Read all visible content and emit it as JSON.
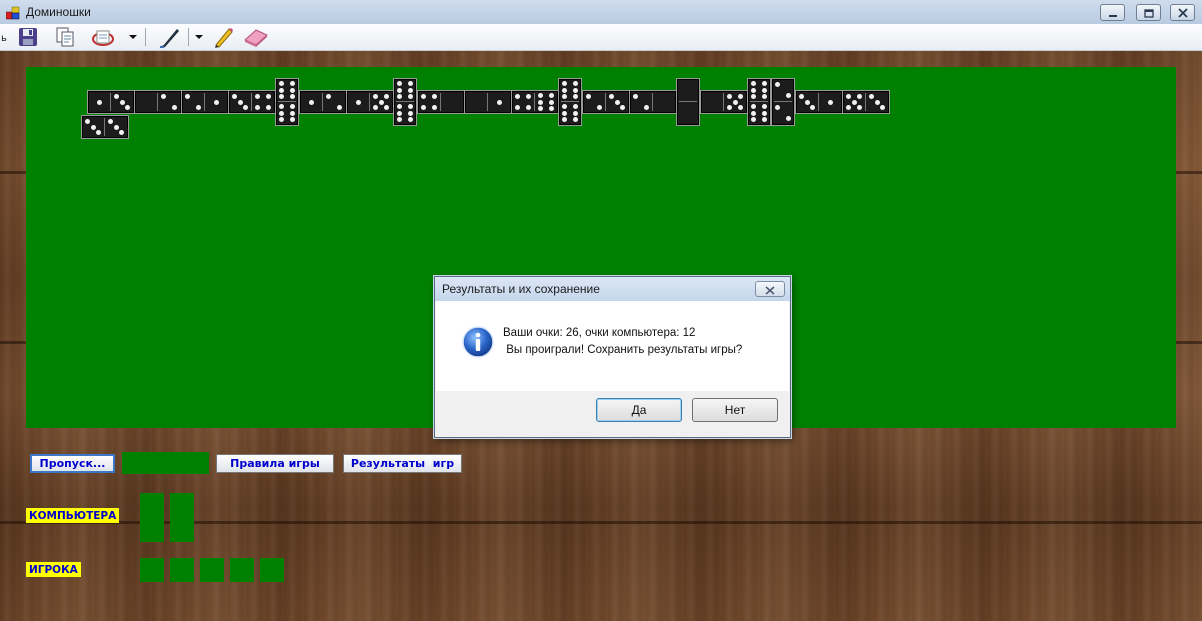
{
  "window": {
    "title": "Доминошки",
    "controls": [
      "minimize",
      "maximize",
      "close"
    ]
  },
  "toolbar": {
    "items": [
      "save-icon",
      "copy-icon",
      "open-icon",
      "dropdown-arrow-icon",
      "pen-icon",
      "dropdown-arrow-icon",
      "pencil-icon",
      "eraser-icon"
    ]
  },
  "board": {
    "background_color": "#008000",
    "chain_row1": [
      [
        1,
        3
      ],
      [
        0,
        2
      ],
      [
        2,
        1
      ],
      [
        3,
        4
      ],
      [
        6,
        6
      ],
      [
        1,
        2
      ],
      [
        1,
        5
      ],
      [
        6,
        6
      ],
      [
        4,
        0
      ],
      [
        0,
        1
      ],
      [
        4,
        6
      ],
      [
        6,
        6
      ],
      [
        2,
        3
      ],
      [
        2,
        0
      ],
      [
        0,
        0
      ],
      [
        0,
        5
      ],
      [
        6,
        6
      ],
      [
        2,
        2
      ],
      [
        3,
        1
      ],
      [
        5,
        3
      ]
    ],
    "chain_row2": [
      [
        3,
        3
      ]
    ]
  },
  "dialog": {
    "title": "Результаты и их сохранение",
    "line1": "Ваши очки: 26, очки компьютера: 12",
    "line2": " Вы проиграли! Сохранить результаты игры?",
    "yes_label": "Да",
    "no_label": "Нет",
    "icon": "info-icon"
  },
  "controls": {
    "skip_label": "Пропуск...",
    "rules_label": "Правила игры",
    "results_label": "Результаты  игр"
  },
  "hands": {
    "computer_label": "КОМПЬЮТЕРА",
    "computer_count": 2,
    "player_label": "ИГРОКА",
    "player_count": 5
  }
}
